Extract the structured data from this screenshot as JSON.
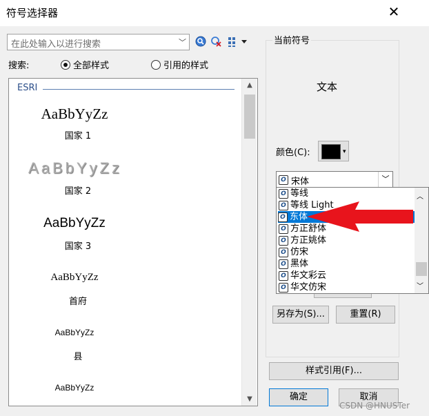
{
  "window": {
    "title": "符号选择器",
    "close_glyph": "✕"
  },
  "search": {
    "placeholder": "在此处输入以进行搜索",
    "label": "搜索:",
    "options": [
      {
        "label": "全部样式",
        "selected": true
      },
      {
        "label": "引用的样式",
        "selected": false
      }
    ]
  },
  "gallery": {
    "group_name": "ESRI",
    "items": [
      {
        "preview": "AaBbYyZz",
        "name": "国家 1"
      },
      {
        "preview": "AaBbYyZz",
        "name": "国家 2"
      },
      {
        "preview": "AaBbYyZz",
        "name": "国家 3"
      },
      {
        "preview": "AaBbYyZz",
        "name": "首府"
      },
      {
        "preview": "AaBbYyZz",
        "name": "县"
      },
      {
        "preview": "AaBbYyZz",
        "name": ""
      }
    ]
  },
  "current": {
    "legend": "当前符号",
    "preview_text": "文本",
    "color_label": "颜色(C):",
    "color_value": "#000000",
    "font_value": "宋体",
    "font_list": [
      "等线",
      "等线 Light",
      "东体",
      "方正舒体",
      "方正姚体",
      "仿宋",
      "黑体",
      "华文彩云",
      "华文仿宋"
    ],
    "font_list_selected_index": 2
  },
  "buttons": {
    "save_as": "另存为(S)...",
    "reset": "重置(R)",
    "style_refs": "样式引用(F)...",
    "ok": "确定",
    "cancel": "取消"
  },
  "watermark": "CSDN @HNUSTer",
  "colors": {
    "arrow": "#e8141c",
    "accent": "#0078d7",
    "group_line": "#5b7db1"
  }
}
